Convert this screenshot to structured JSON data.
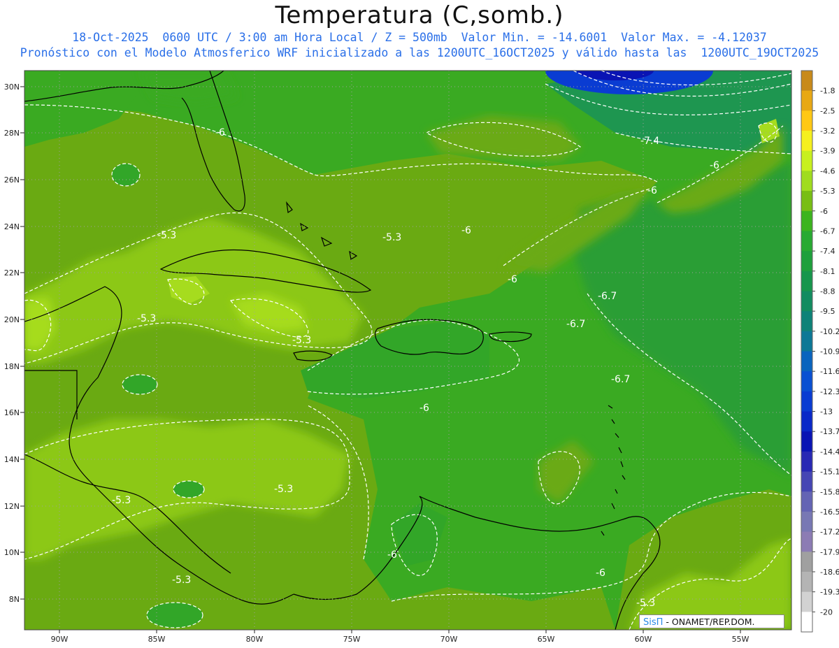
{
  "header": {
    "title": "Temperatura (C,somb.)",
    "line1": "18-Oct-2025  0600 UTC / 3:00 am Hora Local / Z = 500mb  Valor Min. = -14.6001  Valor Max. = -4.12037",
    "line2": "Pronóstico con el Modelo Atmosferico WRF inicializado a las 1200UTC_16OCT2025 y válido hasta las  1200UTC_19OCT2025"
  },
  "axes": {
    "lat_labels": [
      "30N",
      "28N",
      "26N",
      "24N",
      "22N",
      "20N",
      "18N",
      "16N",
      "14N",
      "12N",
      "10N",
      "8N"
    ],
    "lon_labels": [
      "90W",
      "85W",
      "80W",
      "75W",
      "70W",
      "65W",
      "60W",
      "55W"
    ]
  },
  "contour_labels": [
    "-6",
    "-7.4",
    "-6",
    "-6",
    "-5.3",
    "-5.3",
    "-6",
    "-6",
    "-6.7",
    "-5.3",
    "-6.7",
    "-5.3",
    "-6.7",
    "-6",
    "-5.3",
    "-5.3",
    "-5.3",
    "-6",
    "-6",
    "-5.3"
  ],
  "colorbar": {
    "labels": [
      "-1.8",
      "-2.5",
      "-3.2",
      "-3.9",
      "-4.6",
      "-5.3",
      "-6",
      "-6.7",
      "-7.4",
      "-8.1",
      "-8.8",
      "-9.5",
      "-10.2",
      "-10.9",
      "-11.6",
      "-12.3",
      "-13",
      "-13.7",
      "-14.4",
      "-15.1",
      "-15.8",
      "-16.5",
      "-17.2",
      "-17.9",
      "-18.6",
      "-19.3",
      "-20"
    ],
    "colors": [
      "#c88a1a",
      "#e8a814",
      "#ffc814",
      "#f5f01e",
      "#c8f01e",
      "#a0dc1e",
      "#78be14",
      "#3cb41e",
      "#28aa32",
      "#1ea03c",
      "#16964c",
      "#128c60",
      "#0e8278",
      "#0c7896",
      "#0a64be",
      "#0a50d2",
      "#0a3cd2",
      "#0a28c8",
      "#0a14b4",
      "#2828b4",
      "#4646b4",
      "#6464b4",
      "#7878b4",
      "#8c7cb4",
      "#a0a0a0",
      "#b4b4b4",
      "#d2d2d2",
      "#ffffff"
    ]
  },
  "credit": {
    "brand": "SisΠ",
    "text": " - ONAMET/REP.DOM."
  }
}
